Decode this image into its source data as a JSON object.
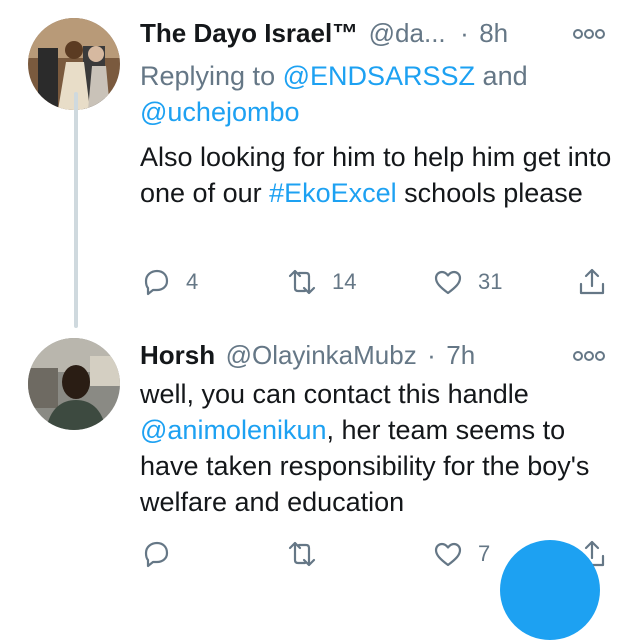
{
  "tweets": [
    {
      "name": "The Dayo Israel™",
      "handle": "@da...",
      "dot": "·",
      "time": "8h",
      "replying_prefix": "Replying to ",
      "replying_user1": "@ENDSARSSZ",
      "replying_and": " and",
      "replying_user2": "@uchejombo",
      "text_part1": "Also looking for him to help him get into one of our ",
      "hashtag": "#EkoExcel",
      "text_part2": " schools please",
      "reply_count": "4",
      "retweet_count": "14",
      "like_count": "31"
    },
    {
      "name": "Horsh",
      "handle": "@OlayinkaMubz",
      "dot": "·",
      "time": "7h",
      "text_part1": "well, you can contact this handle",
      "mention": "@animolenikun",
      "text_part2": ", her team seems to have taken responsibility for the boy's welfare and education",
      "reply_count": "",
      "retweet_count": "",
      "like_count": "7"
    }
  ],
  "icons": {
    "more": "more-options-icon",
    "reply": "reply-icon",
    "retweet": "retweet-icon",
    "like": "heart-icon",
    "share": "share-icon"
  },
  "colors": {
    "accent": "#1da1f2",
    "secondary_text": "#657786",
    "thread_line": "#cfd9de"
  }
}
